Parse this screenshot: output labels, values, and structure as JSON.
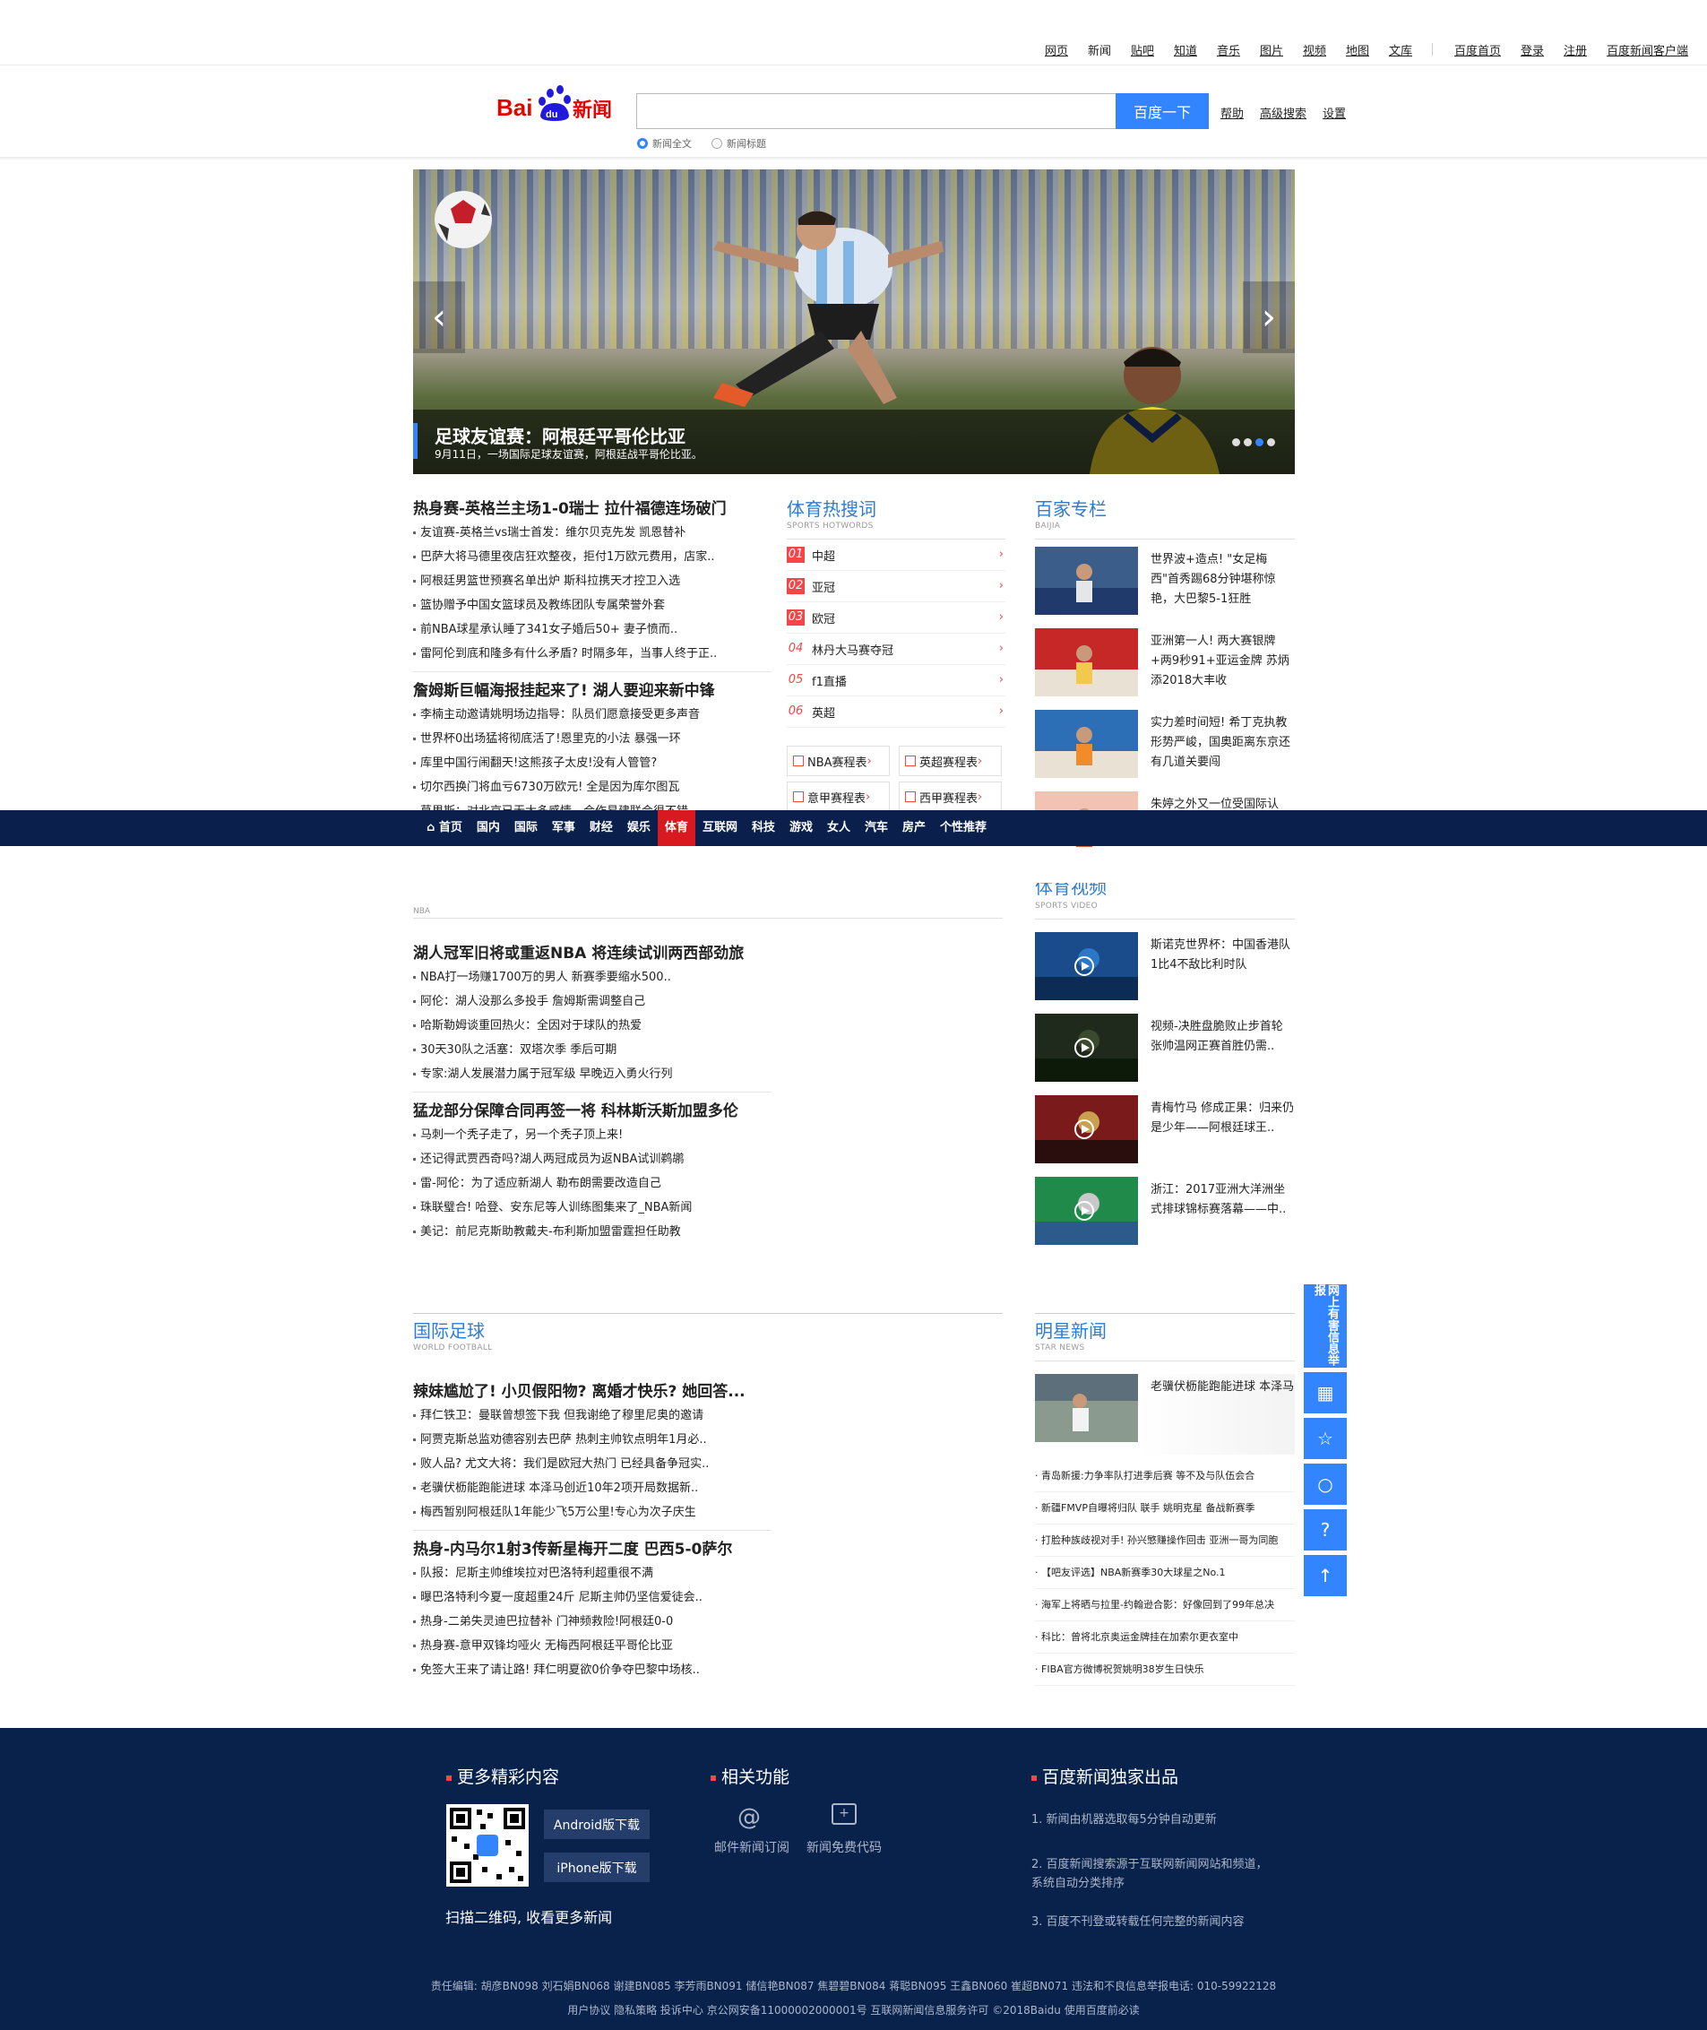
{
  "topnav": {
    "links": [
      "网页",
      "新闻",
      "贴吧",
      "知道",
      "音乐",
      "图片",
      "视频",
      "地图",
      "文库"
    ],
    "right": [
      "百度首页",
      "登录",
      "注册",
      "百度新闻客户端"
    ]
  },
  "search": {
    "logo_text": "Bai新闻",
    "button": "百度一下",
    "links": [
      "帮助",
      "高级搜索",
      "设置"
    ],
    "radio_full": "新闻全文",
    "radio_title": "新闻标题"
  },
  "carousel": {
    "title": "足球友谊赛：阿根廷平哥伦比亚",
    "subtitle": "9月11日，一场国际足球友谊赛，阿根廷战平哥伦比亚。",
    "dots": 4,
    "active_dot": 3
  },
  "left_news": [
    {
      "head": "热身赛-英格兰主场1-0瑞士 拉什福德连场破门",
      "items": [
        "友谊赛-英格兰vs瑞士首发：维尔贝克先发 凯恩替补",
        "巴萨大将马德里夜店狂欢整夜，拒付1万欧元费用，店家..",
        "阿根廷男篮世预赛名单出炉 斯科拉携天才控卫入选",
        "篮协赠予中国女篮球员及教练团队专属荣誉外套",
        "前NBA球星承认睡了341女子婚后50+ 妻子愤而..",
        "雷阿伦到底和隆多有什么矛盾? 时隔多年，当事人终于正.."
      ]
    },
    {
      "head": "詹姆斯巨幅海报挂起来了! 湖人要迎来新中锋",
      "items": [
        "李楠主动邀请姚明场边指导：队员们愿意接受更多声音",
        "世界杯0出场猛将彻底活了!恩里克的小法 暴强一环",
        "库里中国行闹翻天!这熊孩子太皮!没有人管管?",
        "切尔西换门将血亏6730万欧元! 全是因为库尔图瓦",
        "莫里斯：对北京已无太多感情，合作易建联会很不错"
      ]
    }
  ],
  "hotwords": {
    "title": "体育热搜词",
    "sub": "SPORTS HOTWORDS",
    "items": [
      {
        "num": "01",
        "label": "中超"
      },
      {
        "num": "02",
        "label": "亚冠"
      },
      {
        "num": "03",
        "label": "欧冠"
      },
      {
        "num": "04",
        "label": "林丹大马赛夺冠"
      },
      {
        "num": "05",
        "label": "f1直播"
      },
      {
        "num": "06",
        "label": "英超"
      }
    ],
    "schedules": [
      "NBA赛程表",
      "英超赛程表",
      "意甲赛程表",
      "西甲赛程表"
    ]
  },
  "baijia": {
    "title": "百家专栏",
    "sub": "BAIJIA",
    "items": [
      "世界波+造点! \"女足梅西\"首秀踢68分钟堪称惊艳，大巴黎5-1狂胜",
      "亚洲第一人! 两大赛银牌+两9秒91+亚运金牌 苏炳添2018大丰收",
      "实力差时间短! 希丁克执教形势严峻，国奥距离东京还有几道关要闯",
      "朱婷之外又一位受国际认"
    ]
  },
  "channels": [
    "首页",
    "国内",
    "国际",
    "军事",
    "财经",
    "娱乐",
    "体育",
    "互联网",
    "科技",
    "游戏",
    "女人",
    "汽车",
    "房产",
    "个性推荐"
  ],
  "active_channel": "体育",
  "nba": {
    "sub": "NBA",
    "groups": [
      {
        "head": "湖人冠军旧将或重返NBA 将连续试训两西部劲旅",
        "items": [
          "NBA打一场赚1700万的男人 新赛季要缩水500..",
          "阿伦：湖人没那么多投手 詹姆斯需调整自己",
          "哈斯勒姆谈重回热火：全因对于球队的热爱",
          "30天30队之活塞：双塔次季 季后可期",
          "专家:湖人发展潜力属于冠军级 早晚迈入勇火行列"
        ]
      },
      {
        "head": "猛龙部分保障合同再签一将 科林斯沃斯加盟多伦",
        "items": [
          "马刺一个秃子走了，另一个秃子顶上来!",
          "还记得武贾西奇吗?湖人两冠成员为返NBA试训鹈鹕",
          "雷-阿伦：为了适应新湖人 勒布朗需要改造自己",
          "珠联璧合! 哈登、安东尼等人训练图集来了_NBA新闻",
          "美记：前尼克斯助教戴夫-布利斯加盟雷霆担任助教"
        ]
      }
    ]
  },
  "video": {
    "title": "体育视频",
    "sub": "SPORTS VIDEO",
    "items": [
      "斯诺克世界杯：中国香港队1比4不敌比利时队",
      "视频-决胜盘脆败止步首轮 张帅温网正赛首胜仍需..",
      "青梅竹马 修成正果：归来仍是少年——阿根廷球王..",
      "浙江：2017亚洲大洋洲坐式排球锦标赛落幕——中.."
    ]
  },
  "world_football": {
    "title": "国际足球",
    "sub": "WORLD FOOTBALL",
    "groups": [
      {
        "head": "辣妹尴尬了! 小贝假阳物? 离婚才快乐? 她回答...",
        "items": [
          "拜仁铁卫：曼联曾想签下我 但我谢绝了穆里尼奥的邀请",
          "阿贾克斯总监劝德容别去巴萨 热刺主帅钦点明年1月必..",
          "败人品? 尤文大将：我们是欧冠大热门 已经具备争冠实..",
          "老骥伏枥能跑能进球 本泽马创近10年2项开局数据新..",
          "梅西暂别阿根廷队1年能少飞5万公里!专心为次子庆生"
        ]
      },
      {
        "head": "热身-内马尔1射3传新星梅开二度 巴西5-0萨尔",
        "items": [
          "队报：尼斯主帅维埃拉对巴洛特利超重很不满",
          "曝巴洛特利今夏一度超重24斤 尼斯主帅仍坚信爱徒会..",
          "热身-二弟失灵迪巴拉替补 门神频救险!阿根廷0-0",
          "热身赛-意甲双锋均哑火 无梅西阿根廷平哥伦比亚",
          "免签大王来了请让路! 拜仁明夏欲0价争夺巴黎中场核.."
        ]
      }
    ]
  },
  "star": {
    "title": "明星新闻",
    "sub": "STAR NEWS",
    "feature": "老骥伏枥能跑能进球 本泽马",
    "items": [
      "青岛新援:力争率队打进季后赛 等不及与队伍会合",
      "新疆FMVP自曝将归队 联手 姚明克星 备战新赛季",
      "打脸种族歧视对手! 孙兴慜赚操作回击 亚洲一哥为同胞",
      "【吧友评选】NBA新赛季30大球星之No.1",
      "海军上将晒与拉里-约翰逊合影：好像回到了99年总决",
      "科比：曾将北京奥运金牌挂在加索尔更衣室中",
      "FIBA官方微博祝贺姚明38岁生日快乐"
    ]
  },
  "floatbar": {
    "feedback": "网上有害信息举报"
  },
  "footer": {
    "col1_title": "更多精彩内容",
    "android": "Android版下载",
    "iphone": "iPhone版下载",
    "scan": "扫描二维码, 收看更多新闻",
    "col2_title": "相关功能",
    "mail": "邮件新闻订阅",
    "code": "新闻免费代码",
    "col3_title": "百度新闻独家出品",
    "notes": [
      "1. 新闻由机器选取每5分钟自动更新",
      "2. 百度新闻搜索源于互联网新闻网站和频道，系统自动分类排序",
      "3. 百度不刊登或转载任何完整的新闻内容"
    ],
    "line1": "责任编辑: 胡彦BN098 刘石娟BN068 谢建BN085 李芳雨BN091 储信艳BN087 焦碧碧BN084 蒋聪BN095 王鑫BN060 崔超BN071 违法和不良信息举报电话: 010-59922128",
    "line2": "用户协议 隐私策略 投诉中心 京公网安备11000002000001号 互联网新闻信息服务许可 ©2018Baidu 使用百度前必读"
  }
}
